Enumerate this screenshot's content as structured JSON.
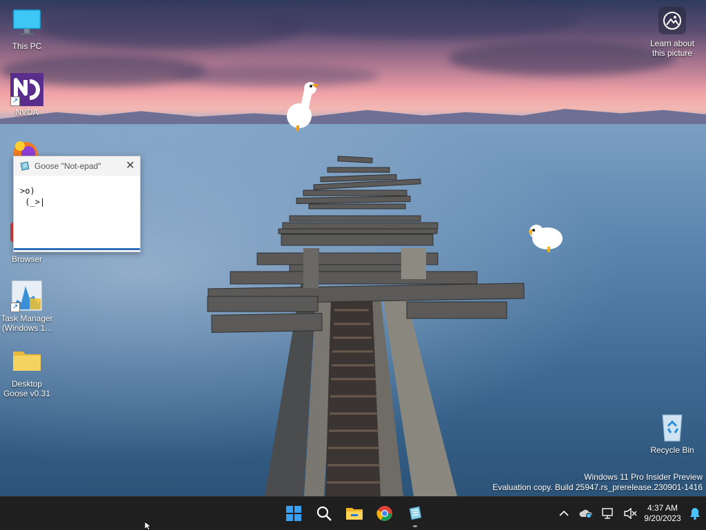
{
  "desktop": {
    "icons": [
      {
        "id": "this-pc",
        "label": "This PC"
      },
      {
        "id": "nvda",
        "label": "NVDA"
      },
      {
        "id": "browser",
        "label": "Browser"
      },
      {
        "id": "task-manager",
        "label": "Task Manager (Windows 1..."
      },
      {
        "id": "desktop-goose",
        "label": "Desktop Goose v0.31"
      },
      {
        "id": "recycle-bin",
        "label": "Recycle Bin"
      }
    ],
    "learn_about_picture": "Learn about this picture"
  },
  "notepad": {
    "title": "Goose \"Not-epad\"",
    "close_glyph": "✕",
    "content": ">o)\n (_>|"
  },
  "watermark": {
    "line1": "Windows 11 Pro Insider Preview",
    "line2": "Evaluation copy. Build 25947.rs_prerelease.230901-1416"
  },
  "taskbar": {
    "apps": [
      {
        "id": "start",
        "icon": "windows-logo-icon"
      },
      {
        "id": "search",
        "icon": "search-icon"
      },
      {
        "id": "file-explorer",
        "icon": "folder-icon"
      },
      {
        "id": "chrome",
        "icon": "chrome-icon"
      },
      {
        "id": "notepad",
        "icon": "notepad-icon",
        "running": true
      }
    ],
    "tray": {
      "time": "4:37 AM",
      "date": "9/20/2023",
      "icons": [
        "chevron-up-icon",
        "onedrive-icon",
        "network-icon",
        "speaker-muted-icon",
        "notification-bell-icon"
      ]
    }
  },
  "colors": {
    "taskbar_bg": "#1f1f1f",
    "accent": "#0078d4",
    "notification_bell": "#4cc2ff"
  }
}
